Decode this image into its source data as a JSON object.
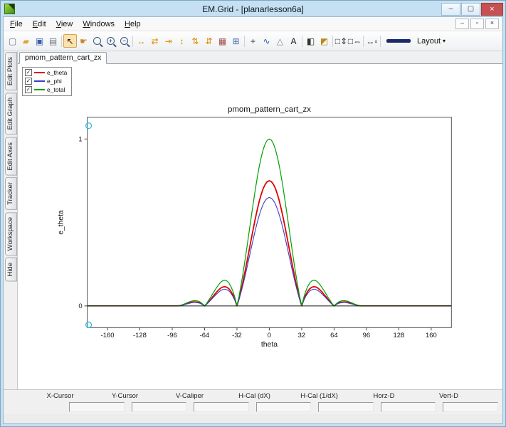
{
  "window": {
    "title": "EM.Grid - [planarlesson6a]",
    "buttons": {
      "minimize": "–",
      "maximize": "▢",
      "close": "×"
    }
  },
  "menu": {
    "items": [
      "File",
      "Edit",
      "View",
      "Windows",
      "Help"
    ],
    "mdi_buttons": {
      "minimize": "–",
      "restore": "▫",
      "close": "×"
    }
  },
  "toolbar": {
    "icons": [
      {
        "name": "new-file-icon",
        "glyph": "▢",
        "color": "#667788"
      },
      {
        "name": "open-folder-icon",
        "glyph": "▰",
        "color": "#e0a23c"
      },
      {
        "name": "save-icon",
        "glyph": "▣",
        "color": "#3a5fae"
      },
      {
        "name": "print-icon",
        "glyph": "▤",
        "color": "#697284"
      },
      {
        "sep": true
      },
      {
        "name": "select-arrow-icon",
        "glyph": "↖",
        "color": "#111111",
        "active": true
      },
      {
        "name": "pan-hand-icon",
        "glyph": "☛",
        "color": "#c9882e"
      },
      {
        "name": "zoom-region-icon",
        "glyph": "",
        "color": "#3a567e",
        "mag": true
      },
      {
        "name": "zoom-in-icon",
        "glyph": "+",
        "color": "#3a567e",
        "mag": true
      },
      {
        "name": "zoom-out-icon",
        "glyph": "−",
        "color": "#3a567e",
        "mag": true
      },
      {
        "sep": true
      },
      {
        "name": "expand-horizontal-icon",
        "glyph": "↔",
        "color": "#e08900"
      },
      {
        "name": "compress-horizontal-icon",
        "glyph": "⇄",
        "color": "#e08900"
      },
      {
        "name": "page-horizontal-icon",
        "glyph": "⇥",
        "color": "#e08900"
      },
      {
        "name": "expand-vertical-icon",
        "glyph": "↕",
        "color": "#e08900"
      },
      {
        "name": "compress-vertical-icon",
        "glyph": "⇅",
        "color": "#e08900"
      },
      {
        "name": "page-vertical-icon",
        "glyph": "⇵",
        "color": "#e08900"
      },
      {
        "name": "data-table-icon",
        "glyph": "▦",
        "color": "#a04848"
      },
      {
        "name": "grid-lines-icon",
        "glyph": "⊞",
        "color": "#4466aa"
      },
      {
        "sep": true
      },
      {
        "name": "add-point-icon",
        "glyph": "+",
        "color": "#222222"
      },
      {
        "name": "curve-fit-icon",
        "glyph": "∿",
        "color": "#2b5bbb"
      },
      {
        "name": "marker-icon",
        "glyph": "△",
        "color": "#888888"
      },
      {
        "name": "text-label-icon",
        "glyph": "A",
        "color": "#161616"
      },
      {
        "sep": true
      },
      {
        "name": "fill-style-icon",
        "glyph": "◧",
        "color": "#333333"
      },
      {
        "name": "colormap-icon",
        "glyph": "◩",
        "color": "#bb8a1d"
      },
      {
        "sep": true
      },
      {
        "name": "v-caliper-icon",
        "glyph": "□⇕",
        "color": "#333333"
      },
      {
        "name": "h-caliper-icon",
        "glyph": "□⇔",
        "color": "#333333"
      },
      {
        "sep": true
      },
      {
        "name": "h-measure-icon",
        "glyph": "↔▫",
        "color": "#333333"
      },
      {
        "sep": true
      }
    ],
    "line_sample_color": "#1b2a6b",
    "layout_label": "Layout",
    "dropdown_arrow": "▾"
  },
  "side_tabs": [
    {
      "label": "Edit Plots"
    },
    {
      "label": "Edit Graph"
    },
    {
      "label": "Edit Axes"
    },
    {
      "label": "Tracker"
    },
    {
      "label": "Workspace"
    },
    {
      "label": "Hide"
    }
  ],
  "doc_tab": {
    "label": "pmom_pattern_cart_zx"
  },
  "legend": {
    "check_glyph": "✓",
    "items": [
      {
        "label": "e_theta",
        "color": "#e00000",
        "checked": true
      },
      {
        "label": "e_phi",
        "color": "#3c3cc8",
        "checked": true
      },
      {
        "label": "e_total",
        "color": "#00a000",
        "checked": true
      }
    ]
  },
  "chart_data": {
    "type": "line",
    "title": "pmom_pattern_cart_zx",
    "xlabel": "theta",
    "ylabel": "e_theta",
    "xlim": [
      -180,
      180
    ],
    "ylim": [
      -0.13,
      1.13
    ],
    "xticks": [
      -160,
      -128,
      -96,
      -64,
      -32,
      0,
      32,
      64,
      96,
      128,
      160
    ],
    "yticks": [
      0,
      1
    ],
    "zero_line": true,
    "legend_position": "top-left",
    "grid": false,
    "x": [
      -180,
      -90,
      -88,
      -86,
      -84,
      -82,
      -80,
      -78,
      -76,
      -74,
      -72,
      -70,
      -68,
      -66,
      -64,
      -62,
      -60,
      -58,
      -56,
      -54,
      -52,
      -50,
      -48,
      -46,
      -44,
      -42,
      -40,
      -38,
      -36,
      -34,
      -32,
      -30,
      -28,
      -26,
      -24,
      -22,
      -20,
      -18,
      -16,
      -14,
      -12,
      -10,
      -8,
      -6,
      -4,
      -2,
      0,
      2,
      4,
      6,
      8,
      10,
      12,
      14,
      16,
      18,
      20,
      22,
      24,
      26,
      28,
      30,
      32,
      34,
      36,
      38,
      40,
      42,
      44,
      46,
      48,
      50,
      52,
      54,
      56,
      58,
      60,
      62,
      64,
      66,
      68,
      70,
      72,
      74,
      76,
      78,
      80,
      82,
      84,
      86,
      88,
      90,
      180
    ],
    "series": [
      {
        "name": "e_theta",
        "color": "#e00000",
        "width": 1.8,
        "values": [
          0,
          0,
          0.002,
          0.005,
          0.009,
          0.013,
          0.017,
          0.02,
          0.023,
          0.024,
          0.023,
          0.021,
          0.016,
          0.009,
          0,
          0.011,
          0.024,
          0.039,
          0.054,
          0.069,
          0.084,
          0.096,
          0.107,
          0.113,
          0.115,
          0.112,
          0.103,
          0.088,
          0.066,
          0.036,
          0,
          0.043,
          0.092,
          0.147,
          0.206,
          0.268,
          0.332,
          0.396,
          0.459,
          0.519,
          0.575,
          0.626,
          0.669,
          0.704,
          0.729,
          0.745,
          0.75,
          0.745,
          0.729,
          0.704,
          0.669,
          0.626,
          0.575,
          0.519,
          0.459,
          0.396,
          0.332,
          0.268,
          0.206,
          0.147,
          0.092,
          0.043,
          0,
          0.036,
          0.066,
          0.088,
          0.103,
          0.112,
          0.115,
          0.113,
          0.107,
          0.096,
          0.084,
          0.069,
          0.054,
          0.039,
          0.024,
          0.011,
          0,
          0.009,
          0.016,
          0.021,
          0.023,
          0.024,
          0.023,
          0.02,
          0.017,
          0.013,
          0.009,
          0.005,
          0.002,
          0,
          0
        ]
      },
      {
        "name": "e_phi",
        "color": "#3c3cc8",
        "width": 1.1,
        "values": [
          0,
          0,
          0.002,
          0.005,
          0.008,
          0.011,
          0.014,
          0.017,
          0.02,
          0.021,
          0.02,
          0.018,
          0.014,
          0.008,
          0,
          0.01,
          0.021,
          0.034,
          0.047,
          0.06,
          0.072,
          0.083,
          0.092,
          0.098,
          0.1,
          0.097,
          0.09,
          0.076,
          0.057,
          0.032,
          0,
          0.037,
          0.08,
          0.127,
          0.178,
          0.232,
          0.287,
          0.343,
          0.398,
          0.45,
          0.499,
          0.542,
          0.58,
          0.61,
          0.632,
          0.645,
          0.65,
          0.645,
          0.632,
          0.61,
          0.58,
          0.542,
          0.499,
          0.45,
          0.398,
          0.343,
          0.287,
          0.232,
          0.178,
          0.127,
          0.08,
          0.037,
          0,
          0.032,
          0.057,
          0.076,
          0.09,
          0.097,
          0.1,
          0.098,
          0.092,
          0.083,
          0.072,
          0.06,
          0.047,
          0.034,
          0.021,
          0.01,
          0,
          0.008,
          0.014,
          0.018,
          0.02,
          0.021,
          0.02,
          0.017,
          0.014,
          0.011,
          0.008,
          0.005,
          0.002,
          0,
          0
        ]
      },
      {
        "name": "e_total",
        "color": "#00a000",
        "width": 1.2,
        "values": [
          0,
          0,
          0.003,
          0.007,
          0.012,
          0.017,
          0.022,
          0.027,
          0.03,
          0.032,
          0.031,
          0.028,
          0.022,
          0.012,
          0,
          0.015,
          0.033,
          0.052,
          0.072,
          0.092,
          0.111,
          0.128,
          0.142,
          0.151,
          0.154,
          0.15,
          0.138,
          0.117,
          0.088,
          0.049,
          0,
          0.057,
          0.123,
          0.196,
          0.274,
          0.357,
          0.442,
          0.528,
          0.612,
          0.692,
          0.767,
          0.834,
          0.892,
          0.938,
          0.972,
          0.993,
          1,
          0.993,
          0.972,
          0.938,
          0.892,
          0.834,
          0.767,
          0.692,
          0.612,
          0.528,
          0.442,
          0.357,
          0.274,
          0.196,
          0.123,
          0.057,
          0,
          0.049,
          0.088,
          0.117,
          0.138,
          0.15,
          0.154,
          0.151,
          0.142,
          0.128,
          0.111,
          0.092,
          0.072,
          0.052,
          0.033,
          0.015,
          0,
          0.012,
          0.022,
          0.028,
          0.031,
          0.032,
          0.03,
          0.027,
          0.022,
          0.017,
          0.012,
          0.007,
          0.003,
          0,
          0
        ]
      }
    ]
  },
  "status_table": {
    "headers": [
      "X-Cursor",
      "Y-Cursor",
      "V-Caliper",
      "H-Cal (dX)",
      "H-Cal (1/dX)",
      "Horz-D",
      "Vert-D"
    ],
    "values": [
      "",
      "",
      "",
      "",
      "",
      "",
      ""
    ]
  },
  "colors": {
    "titlebar": "#c4e0f2",
    "close_button": "#c75050",
    "selection_handle": "#2fc1e0"
  }
}
